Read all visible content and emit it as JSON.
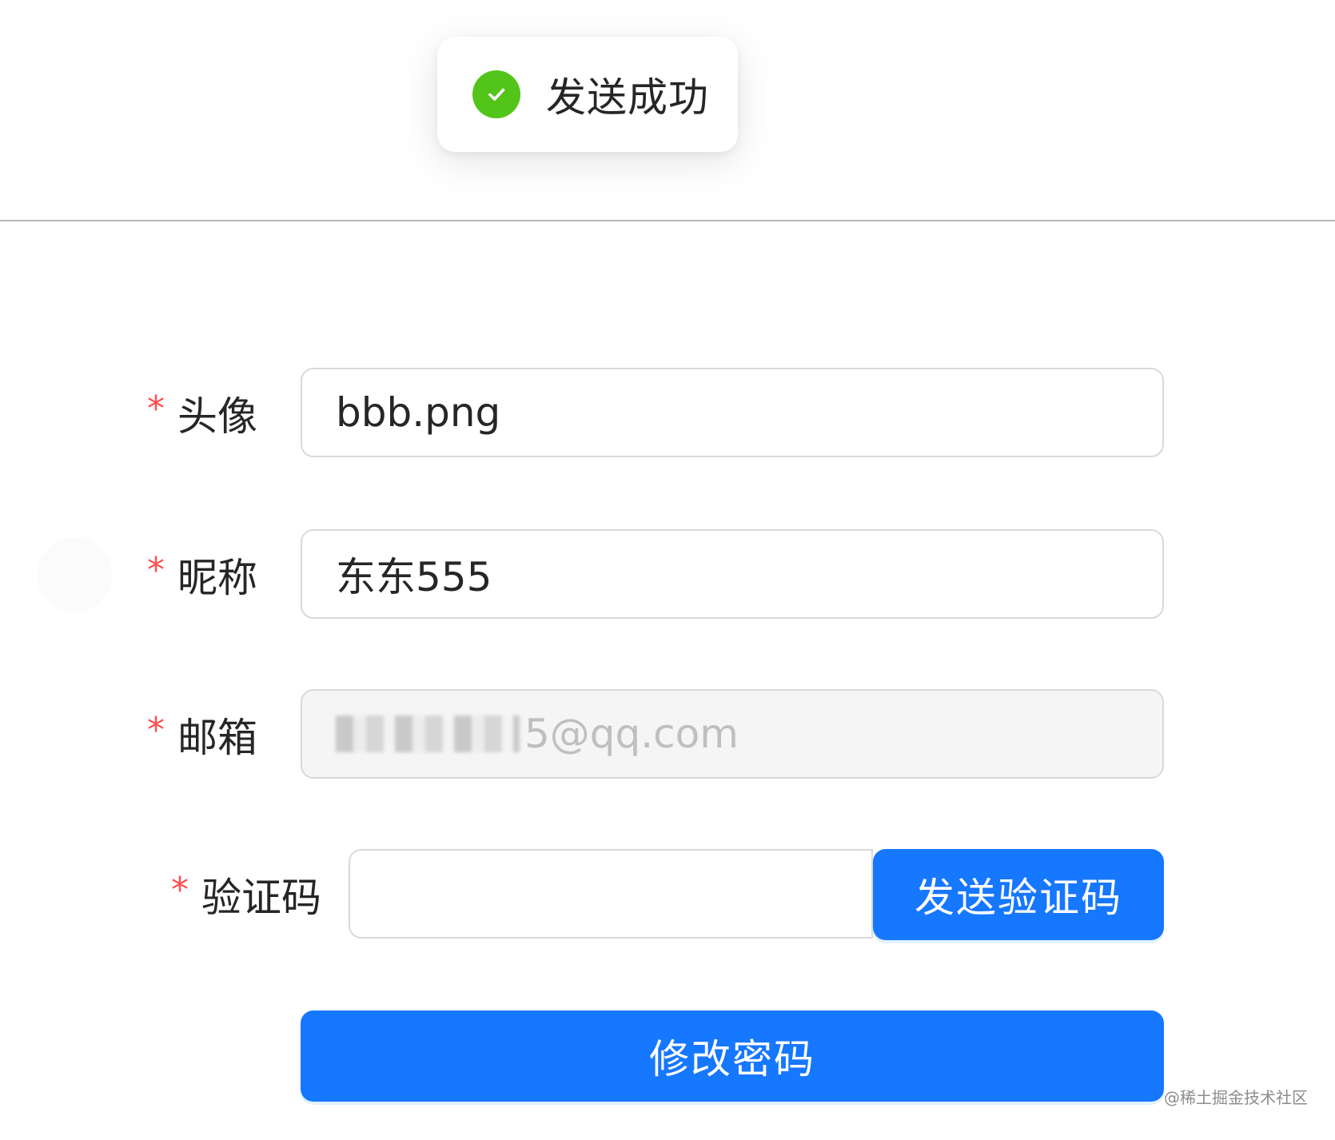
{
  "toast": {
    "icon": "check-circle-icon",
    "message": "发送成功",
    "color": "#52c41a"
  },
  "form": {
    "avatar": {
      "required_mark": "*",
      "label": "头像",
      "value": "bbb.png"
    },
    "nickname": {
      "required_mark": "*",
      "label": "昵称",
      "value": "东东555"
    },
    "email": {
      "required_mark": "*",
      "label": "邮箱",
      "value_visible_suffix": "5@qq.com",
      "disabled": true
    },
    "code": {
      "required_mark": "*",
      "label": "验证码",
      "value": "",
      "send_button_label": "发送验证码"
    },
    "submit_label": "修改密码"
  },
  "watermark": "@稀土掘金技术社区",
  "colors": {
    "primary": "#1677ff",
    "required": "#ff4d4f",
    "success": "#52c41a"
  }
}
